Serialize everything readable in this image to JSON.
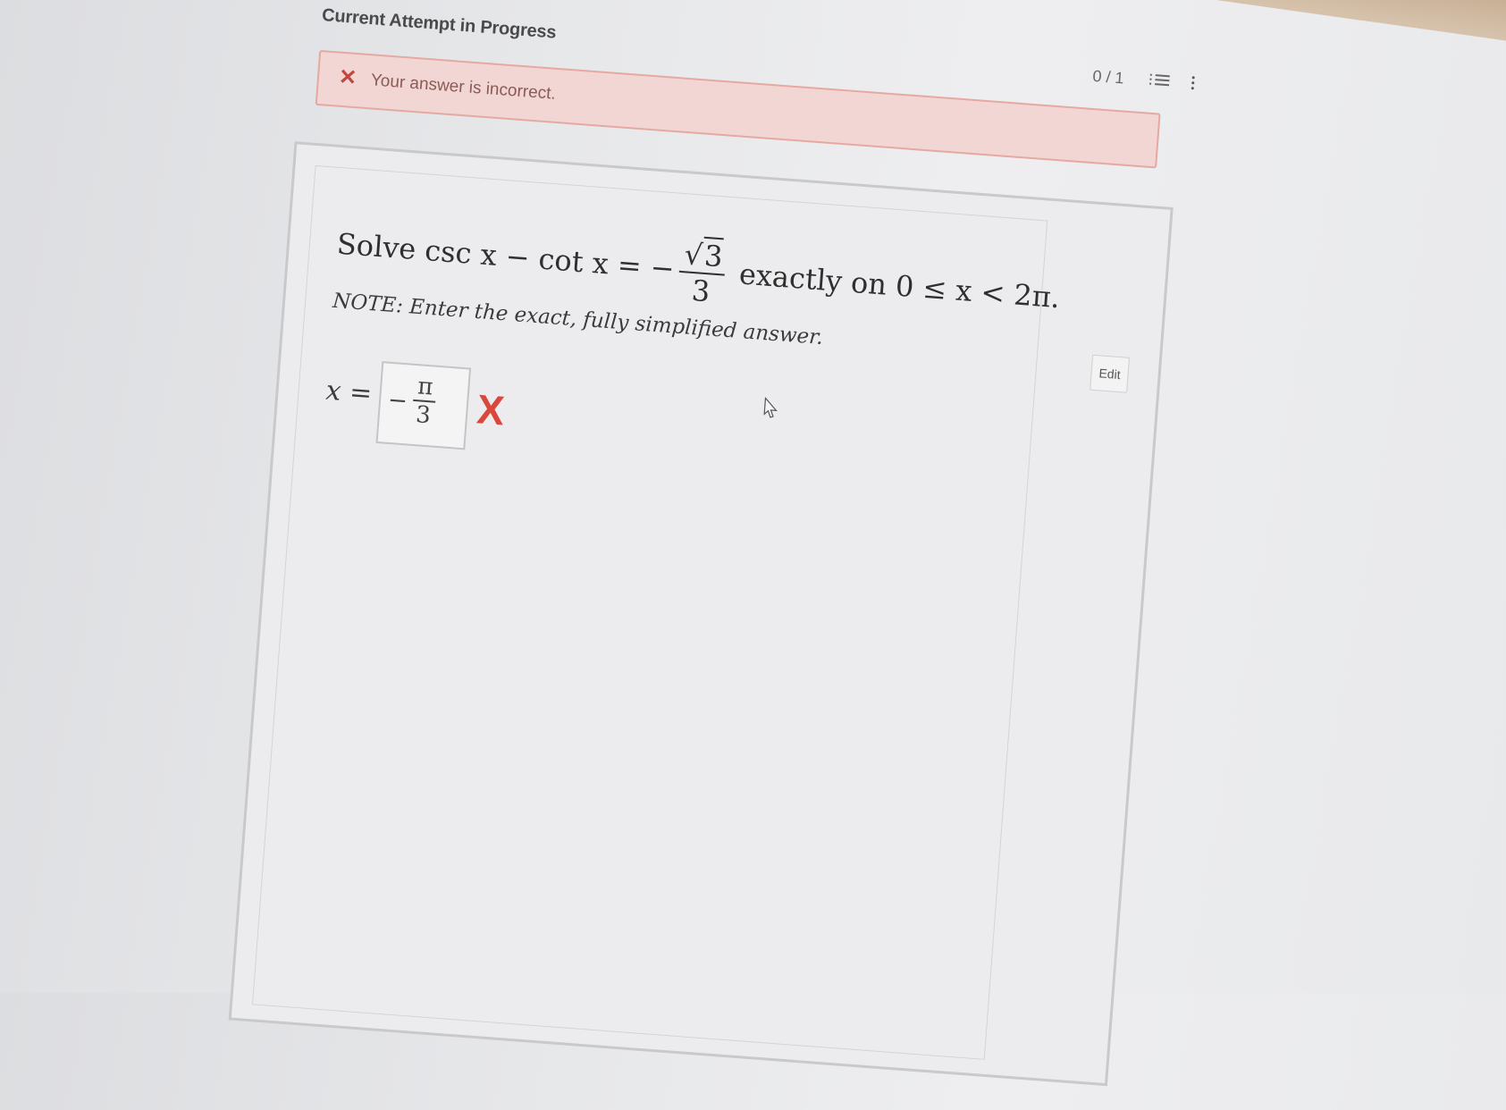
{
  "header": {
    "title": "Current Attempt in Progress",
    "score": "0 / 1"
  },
  "alert": {
    "message": "Your answer is incorrect."
  },
  "question": {
    "prefix": "Solve csc x − cot x = −",
    "frac_num": "3",
    "frac_den": "3",
    "suffix": "exactly on 0 ≤ x < 2π.",
    "note": "NOTE: Enter the exact, fully simplified answer."
  },
  "answer": {
    "label": "x =",
    "sign": "−",
    "num": "π",
    "den": "3",
    "status_mark": "X"
  },
  "buttons": {
    "edit": "Edit"
  },
  "icons": {
    "incorrect": "x-icon",
    "list": "list-icon",
    "more": "more-vertical-icon"
  },
  "colors": {
    "error": "#d9473d",
    "alert_bg": "#f2d6d3"
  }
}
